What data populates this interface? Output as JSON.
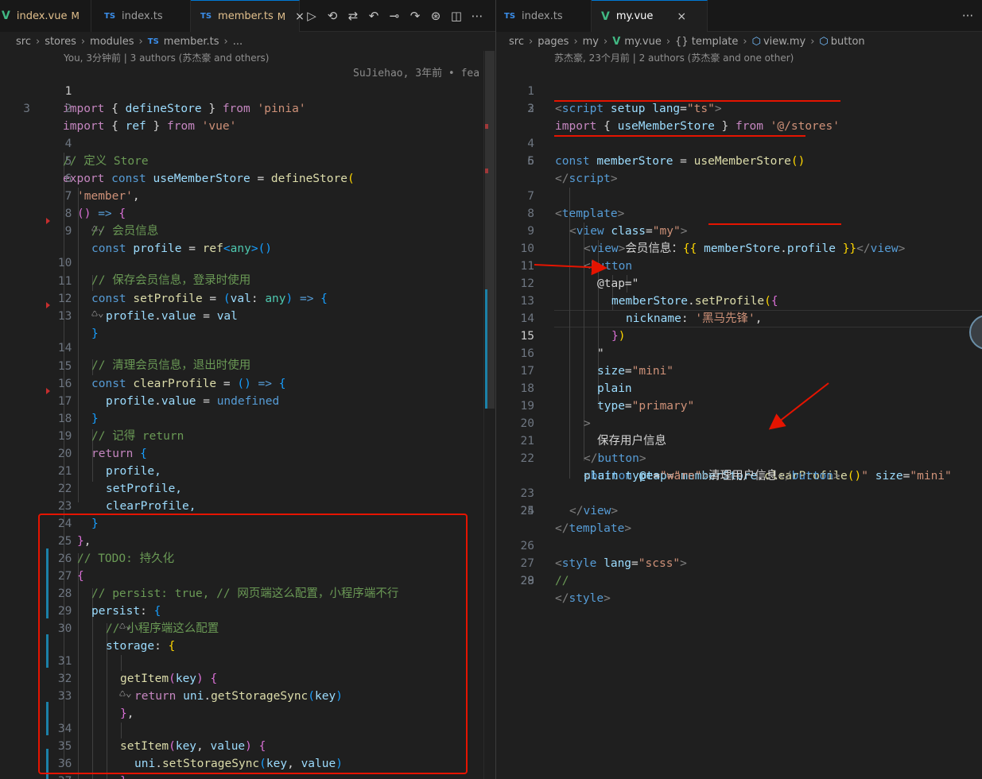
{
  "left": {
    "tabs": [
      {
        "name": "index.vue",
        "type": "vue",
        "modified": "M"
      },
      {
        "name": "index.ts",
        "type": "ts"
      },
      {
        "name": "member.ts",
        "type": "ts",
        "modified": "M",
        "active": true
      }
    ],
    "toolbar_icons": [
      "run-icon",
      "timeline-icon",
      "compare-icon",
      "diff-prev-icon",
      "commit-icon",
      "diff-next-icon",
      "git-graph-icon",
      "split-editor-icon",
      "more-icon"
    ],
    "breadcrumb": [
      "src",
      "stores",
      "modules",
      "member.ts",
      "..."
    ],
    "blame": "You, 3分钟前 | 3 authors (苏杰豪 and others)",
    "inline_blame": "SuJiehao, 3年前 • fea",
    "line_numbers": [
      "1",
      "2",
      "3",
      "4",
      "5",
      "6",
      "7",
      "8",
      "9",
      "10",
      "11",
      "12",
      "13",
      "14",
      "15",
      "16",
      "17",
      "18",
      "19",
      "20",
      "21",
      "22",
      "23",
      "24",
      "25",
      "26",
      "27",
      "28",
      "29",
      "30",
      "31",
      "32",
      "33",
      "34",
      "35",
      "36",
      "37"
    ],
    "code": {
      "l1a": "import",
      "l1b": " { ",
      "l1c": "defineStore",
      "l1d": " } ",
      "l1e": "from",
      "l1f": " ",
      "l1g": "'pinia'",
      "l2a": "import",
      "l2b": " { ",
      "l2c": "ref",
      "l2d": " } ",
      "l2e": "from",
      "l2f": " ",
      "l2g": "'vue'",
      "l4": "// 定义 Store",
      "l5a": "export",
      "l5b": " const ",
      "l5c": "useMemberStore",
      "l5d": " = ",
      "l5e": "defineStore",
      "l5f": "(",
      "l6a": "'member'",
      "l6b": ",",
      "l7a": "()",
      "l7b": " => ",
      "l7c": "{",
      "l8": "// 会员信息",
      "l9a": "const",
      "l9b": " ",
      "l9c": "profile",
      "l9d": " = ",
      "l9e": "ref",
      "l9f": "<",
      "l9g": "any",
      "l9h": ">",
      "l9i": "()",
      "l10": "// 保存会员信息，登录时使用",
      "l11a": "const",
      "l11b": " ",
      "l11c": "setProfile",
      "l11d": " = ",
      "l11e": "(",
      "l11f": "val",
      "l11g": ": ",
      "l11h": "any",
      "l11i": ")",
      "l11j": " => ",
      "l11k": "{",
      "l12a": "profile",
      "l12b": ".",
      "l12c": "value",
      "l12d": " = ",
      "l12e": "val",
      "l13": "}",
      "l14": "// 清理会员信息，退出时使用",
      "l15a": "const",
      "l15b": " ",
      "l15c": "clearProfile",
      "l15d": " = ",
      "l15e": "()",
      "l15f": " => ",
      "l15g": "{",
      "l16a": "profile",
      "l16b": ".",
      "l16c": "value",
      "l16d": " = ",
      "l16e": "undefined",
      "l17": "}",
      "l18": "// 记得 return",
      "l19a": "return",
      "l19b": " ",
      "l19c": "{",
      "l20": "profile,",
      "l21": "setProfile,",
      "l22": "clearProfile,",
      "l23": "}",
      "l24a": "}",
      "l24b": ",",
      "l25": "// TODO: 持久化",
      "l26": "{",
      "l27": "// persist: true, // 网页端这么配置，小程序端不行",
      "l28a": "persist",
      "l28b": ": ",
      "l28c": "{",
      "l29": "// 小程序端这么配置",
      "l30a": "storage",
      "l30b": ": ",
      "l30c": "{",
      "l31a": "getItem",
      "l31b": "(",
      "l31c": "key",
      "l31d": ")",
      "l31e": " ",
      "l31f": "{",
      "l32a": "return",
      "l32b": " ",
      "l32c": "uni",
      "l32d": ".",
      "l32e": "getStorageSync",
      "l32f": "(",
      "l32g": "key",
      "l32h": ")",
      "l33a": "}",
      "l33b": ",",
      "l34a": "setItem",
      "l34b": "(",
      "l34c": "key",
      "l34d": ", ",
      "l34e": "value",
      "l34f": ")",
      "l34g": " ",
      "l34h": "{",
      "l35a": "uni",
      "l35b": ".",
      "l35c": "setStorageSync",
      "l35d": "(",
      "l35e": "key",
      "l35f": ", ",
      "l35g": "value",
      "l35h": ")",
      "l36a": "}",
      "l36b": ",",
      "l37a": "}",
      "l37b": ","
    }
  },
  "right": {
    "tabs": [
      {
        "name": "index.ts",
        "type": "ts"
      },
      {
        "name": "my.vue",
        "type": "vue",
        "active": true,
        "close": "×"
      }
    ],
    "more_icon": "···",
    "breadcrumb": [
      "src",
      "pages",
      "my",
      "my.vue",
      "{} template",
      "view.my",
      "button"
    ],
    "blame": "苏杰豪, 23个月前 | 2 authors (苏杰豪 and one other)",
    "line_numbers": [
      "1",
      "2",
      "3",
      "4",
      "5",
      "6",
      "7",
      "8",
      "9",
      "10",
      "11",
      "12",
      "13",
      "14",
      "15",
      "16",
      "17",
      "18",
      "19",
      "20",
      "21",
      "22",
      "23",
      "24",
      "25",
      "26",
      "27",
      "28",
      "29"
    ],
    "current_line": "15",
    "code": {
      "r1a": "<",
      "r1b": "script",
      "r1c": " setup",
      "r1d": " lang",
      "r1e": "=",
      "r1f": "\"ts\"",
      "r1g": ">",
      "r2a": "import",
      "r2b": " { ",
      "r2c": "useMemberStore",
      "r2d": " } ",
      "r2e": "from",
      "r2f": " ",
      "r2g": "'@/stores'",
      "r4a": "const",
      "r4b": " ",
      "r4c": "memberStore",
      "r4d": " = ",
      "r4e": "useMemberStore",
      "r4f": "()",
      "r5a": "</",
      "r5b": "script",
      "r5c": ">",
      "r7a": "<",
      "r7b": "template",
      "r7c": ">",
      "r8a": "<",
      "r8b": "view",
      "r8c": " class",
      "r8d": "=",
      "r8e": "\"my\"",
      "r8f": ">",
      "r9a": "<",
      "r9b": "view",
      "r9c": ">",
      "r9d": "会员信息：",
      "r9e": "{{ ",
      "r9f": "memberStore",
      "r9g": ".",
      "r9h": "profile",
      "r9i": " }}",
      "r9j": "</",
      "r9k": "view",
      "r9l": ">",
      "r10a": "<",
      "r10b": "button",
      "r11": "@tap=\"",
      "r12a": "memberStore",
      "r12b": ".",
      "r12c": "setProfile",
      "r12d": "(",
      "r12e": "{",
      "r13a": "nickname",
      "r13b": ": ",
      "r13c": "'黑马先锋'",
      "r13d": ",",
      "r14a": "}",
      "r14b": ")",
      "r15": "\"",
      "r16a": "size",
      "r16b": "=",
      "r16c": "\"mini\"",
      "r17": "plain",
      "r18a": "type",
      "r18b": "=",
      "r18c": "\"primary\"",
      "r19": ">",
      "r20": "保存用户信息",
      "r21a": "</",
      "r21b": "button",
      "r21c": ">",
      "r22a": "<",
      "r22b": "button",
      "r22c": " @tap",
      "r22d": "=",
      "r22e": "\"",
      "r22f": "memberStore",
      "r22g": ".",
      "r22h": "clearProfile",
      "r22i": "()",
      "r22j": "\"",
      "r22k": " size",
      "r22l": "=",
      "r22m": "\"mini\"",
      "r22n": "plain",
      "r22o": " type",
      "r22p": "=",
      "r22q": "\"warn\"",
      "r22r": ">",
      "r22s": "清理用户信息",
      "r22t": "</",
      "r22u": "button",
      "r22v": ">",
      "r23a": "</",
      "r23b": "view",
      "r23c": ">",
      "r24a": "</",
      "r24b": "template",
      "r24c": ">",
      "r26a": "<",
      "r26b": "style",
      "r26c": " lang",
      "r26d": "=",
      "r26e": "\"scss\"",
      "r26f": ">",
      "r27": "//",
      "r28a": "</",
      "r28b": "style",
      "r28c": ">"
    }
  },
  "colors": {
    "annotation_red": "#e51400",
    "background": "#1f1f1f",
    "keyword": "#c586c0",
    "function": "#dcdcaa",
    "variable": "#9cdcfe",
    "string": "#ce9178",
    "comment": "#6a9955"
  }
}
